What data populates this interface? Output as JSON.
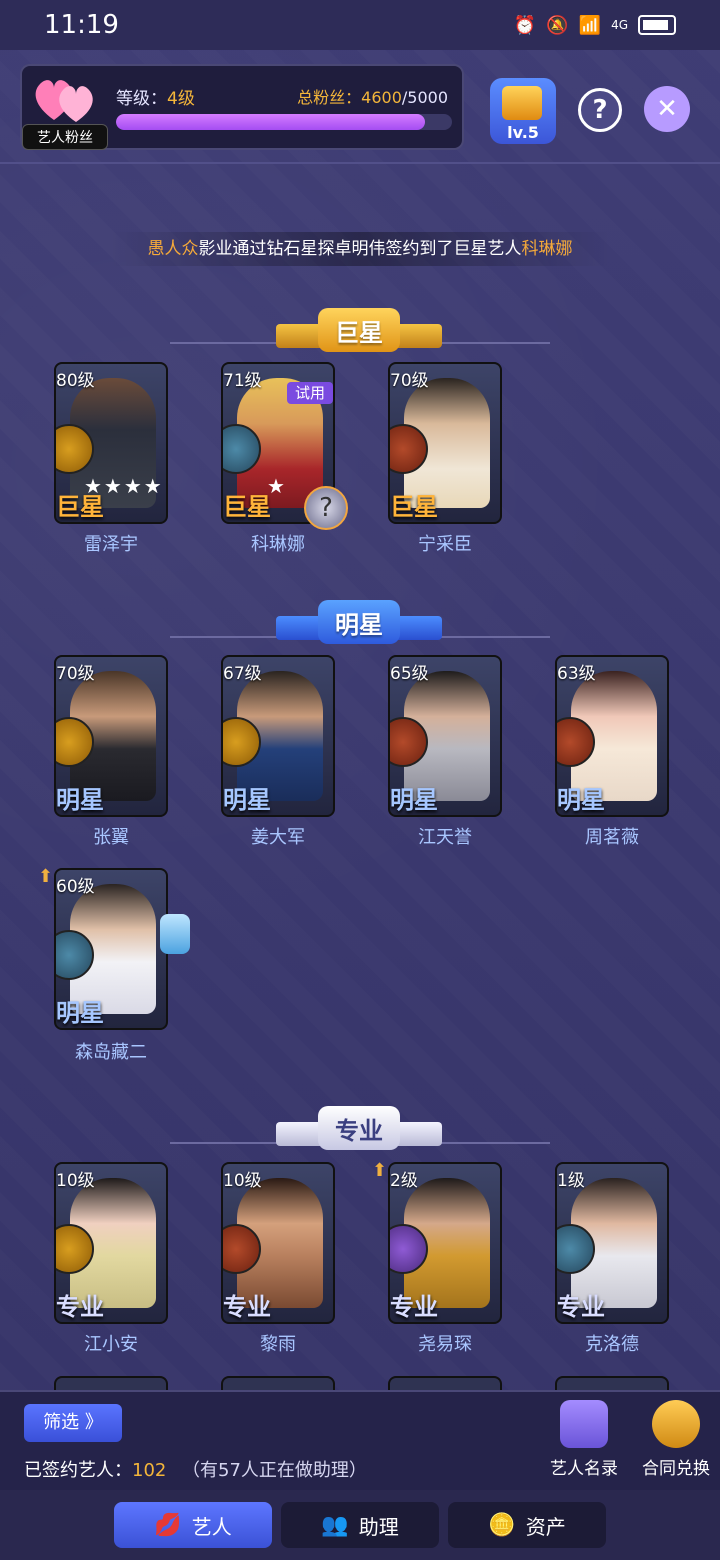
{
  "status_bar": {
    "time": "11:19",
    "network": "4G"
  },
  "header": {
    "fan_label": "艺人粉丝",
    "level_label": "等级：",
    "level_value": "4级",
    "fans_label": "总粉丝：",
    "fans_current": "4600",
    "fans_max": "/5000",
    "fans_progress": 0.92,
    "lv_badge": "lv.5",
    "help_glyph": "?",
    "close_glyph": "✕"
  },
  "notice": {
    "company": "愚人众",
    "middle": "影业通过钻石星探卓明伟签约到了巨星艺人",
    "artist": "科琳娜"
  },
  "sections": {
    "superstar": "巨星",
    "star": "明星",
    "pro": "专业"
  },
  "superstar_cards": [
    {
      "level": "80级",
      "tier": "巨星",
      "name": "雷泽宇",
      "stars": "★★★★"
    },
    {
      "level": "71级",
      "tier": "巨星",
      "name": "科琳娜",
      "stars": "★",
      "badge": "试用"
    },
    {
      "level": "70级",
      "tier": "巨星",
      "name": "宁采臣"
    }
  ],
  "star_cards": [
    {
      "level": "70级",
      "tier": "明星",
      "name": "张翼"
    },
    {
      "level": "67级",
      "tier": "明星",
      "name": "姜大军"
    },
    {
      "level": "65级",
      "tier": "明星",
      "name": "江天誉"
    },
    {
      "level": "63级",
      "tier": "明星",
      "name": "周茗薇"
    },
    {
      "level": "60级",
      "tier": "明星",
      "name": "森岛藏二"
    }
  ],
  "pro_cards": [
    {
      "level": "10级",
      "tier": "专业",
      "name": "江小安"
    },
    {
      "level": "10级",
      "tier": "专业",
      "name": "黎雨"
    },
    {
      "level": "2级",
      "tier": "专业",
      "name": "尧易琛"
    },
    {
      "level": "1级",
      "tier": "专业",
      "name": "克洛德"
    }
  ],
  "bottom_panel": {
    "filter": "筛选 》",
    "signed_label": "已签约艺人：",
    "signed_count": "102",
    "assist_note": "（有57人正在做助理）",
    "roster": "艺人名录",
    "exchange": "合同兑换"
  },
  "tabs": [
    "艺人",
    "助理",
    "资产"
  ]
}
